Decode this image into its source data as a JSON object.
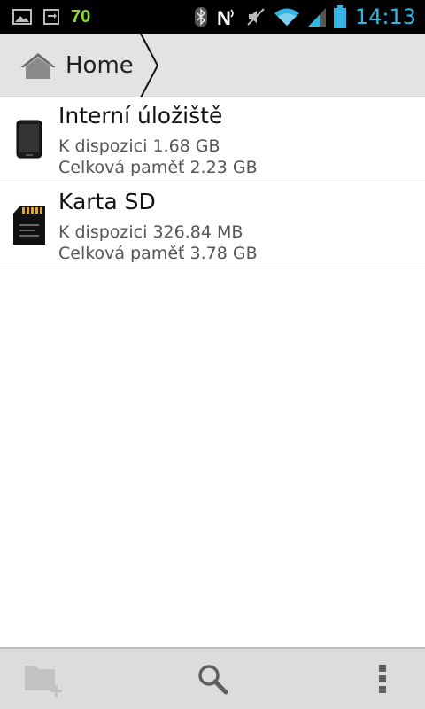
{
  "status_bar": {
    "battery_level": "70",
    "time": "14:13",
    "icons": [
      "picture-icon",
      "sync-icon",
      "bluetooth-icon",
      "nfc-icon",
      "mute-icon",
      "wifi-icon",
      "signal-icon",
      "battery-icon"
    ]
  },
  "breadcrumb": {
    "home_label": "Home"
  },
  "storage": [
    {
      "title": "Interní úložiště",
      "available": "K dispozici 1.68 GB",
      "total": "Celková paměť 2.23 GB",
      "icon": "phone-storage-icon"
    },
    {
      "title": "Karta SD",
      "available": "K dispozici 326.84 MB",
      "total": "Celková paměť 3.78 GB",
      "icon": "sd-card-icon"
    }
  ],
  "actions": [
    "new-folder-icon",
    "search-icon",
    "overflow-menu-icon"
  ],
  "colors": {
    "time": "#33b5e5",
    "battery_text": "#8fd81e",
    "breadcrumb_bg": "#e3e3e3",
    "bottom_bar_bg": "#dcdcdc"
  }
}
